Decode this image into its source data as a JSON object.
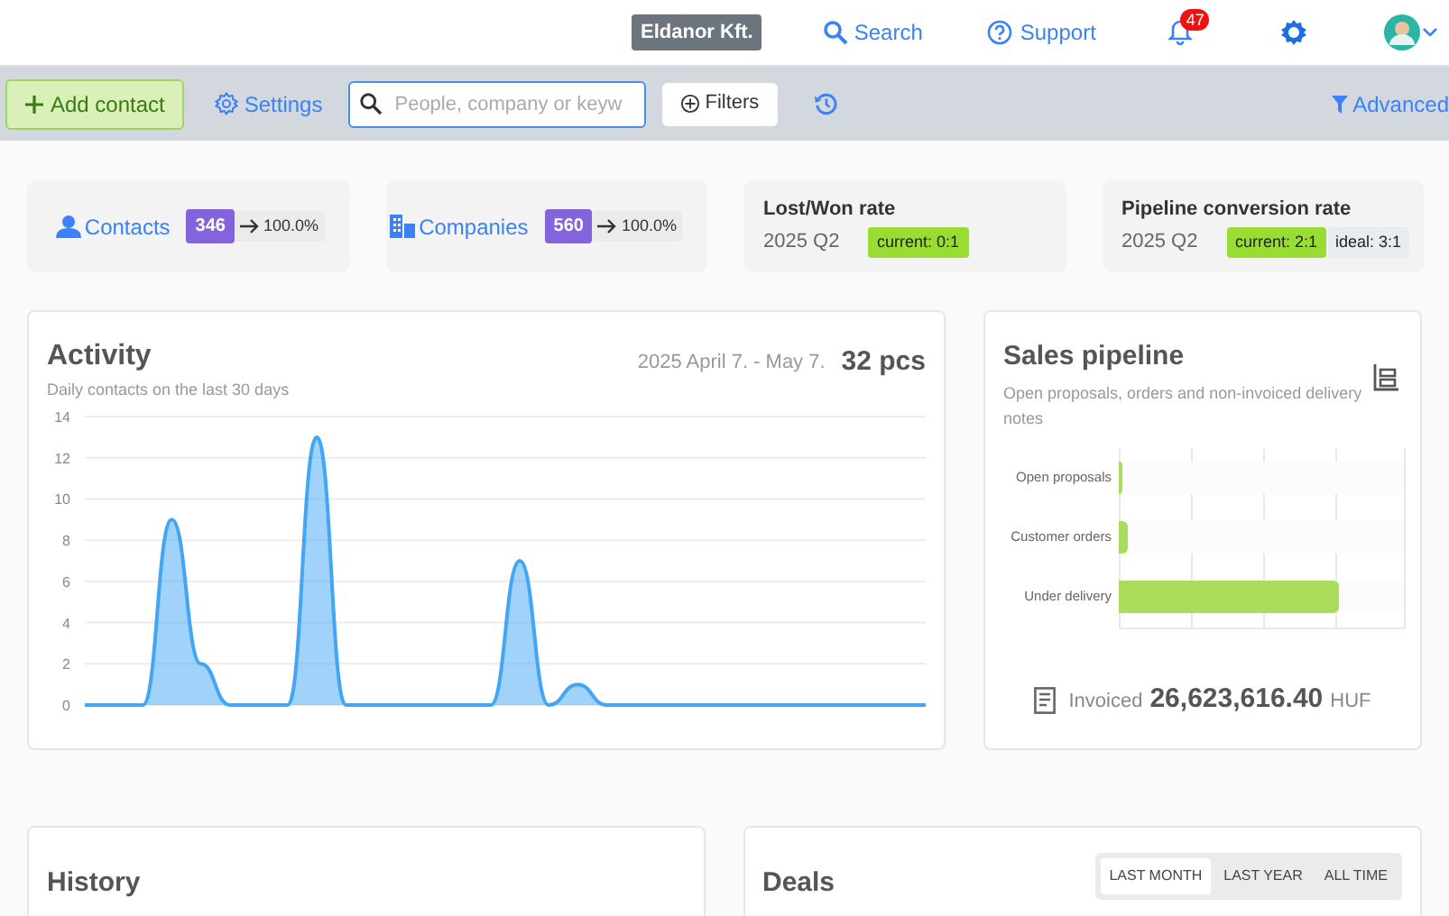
{
  "topbar": {
    "company": "Eldanor Kft.",
    "search": "Search",
    "support": "Support",
    "notifications": "47"
  },
  "toolbar": {
    "add_button": "Add contact",
    "settings": "Settings",
    "search_placeholder": "People, company or keyw",
    "filters": "Filters",
    "advanced": "Advanced"
  },
  "stat_cards": [
    {
      "kind": "count",
      "label": "Contacts",
      "count": "346",
      "change": "100.0%"
    },
    {
      "kind": "count",
      "label": "Companies",
      "count": "560",
      "change": "100.0%"
    },
    {
      "kind": "rate",
      "title": "Lost/Won rate",
      "period": "2025 Q2",
      "current": "current: 0:1"
    },
    {
      "kind": "rate",
      "title": "Pipeline conversion rate",
      "period": "2025 Q2",
      "current": "current: 2:1",
      "ideal": "ideal: 3:1"
    }
  ],
  "activity": {
    "title": "Activity",
    "subtitle": "Daily contacts on the last 30 days",
    "range": "2025 April 7. - May 7.",
    "total": "32 pcs",
    "chart_data": {
      "type": "area",
      "grid": true,
      "ylim": [
        0,
        14
      ],
      "yticks": [
        0,
        2,
        4,
        6,
        8,
        10,
        12,
        14
      ],
      "series": [
        {
          "color": "#42a5f5",
          "values": [
            0,
            0,
            0,
            9,
            2,
            0,
            0,
            0,
            13,
            0,
            0,
            0,
            0,
            0,
            0,
            7,
            0,
            1,
            0,
            0,
            0,
            0,
            0,
            0,
            0,
            0,
            0,
            0,
            0,
            0
          ]
        }
      ]
    }
  },
  "pipeline": {
    "title": "Sales pipeline",
    "subtitle": "Open proposals, orders and non-invoiced delivery notes",
    "bars": [
      {
        "label": "Open proposals",
        "level": 0.01
      },
      {
        "label": "Customer orders",
        "level": 0.03
      },
      {
        "label": "Under delivery",
        "level": 0.77
      }
    ],
    "invoiced_label": "Invoiced",
    "invoiced_amount": "26,623,616.40",
    "currency": "HUF"
  },
  "history": {
    "title": "History"
  },
  "deals": {
    "title": "Deals",
    "tabs": [
      {
        "label": "LAST MONTH",
        "selected": true
      },
      {
        "label": "LAST YEAR",
        "selected": false
      },
      {
        "label": "ALL TIME",
        "selected": false
      }
    ]
  }
}
